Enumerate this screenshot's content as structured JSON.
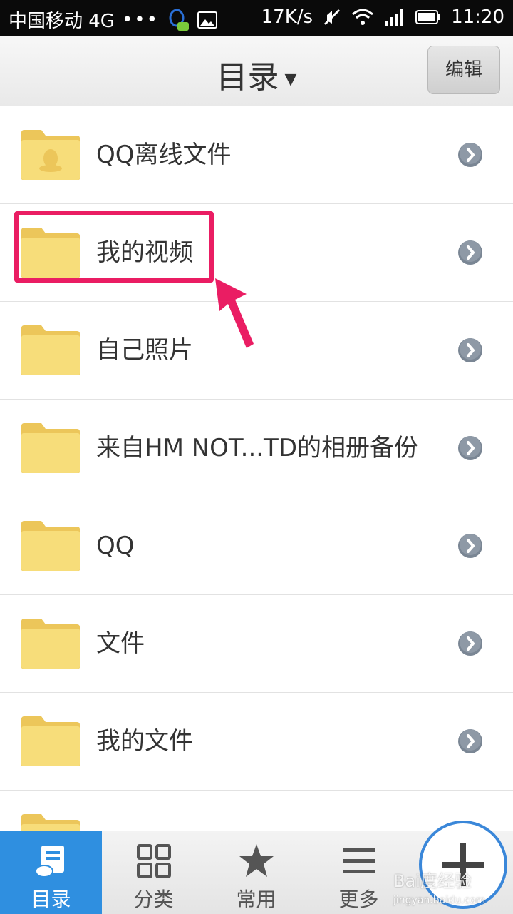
{
  "status_bar": {
    "carrier": "中国移动 4G",
    "dots": "•••",
    "speed": "17K/s",
    "time": "11:20"
  },
  "header": {
    "title": "目录",
    "edit_label": "编辑"
  },
  "folders": [
    {
      "label": "QQ离线文件",
      "icon": "qq-folder-icon"
    },
    {
      "label": "我的视频",
      "icon": "folder-icon"
    },
    {
      "label": "自己照片",
      "icon": "folder-icon"
    },
    {
      "label": "来自HM NOT...TD的相册备份",
      "icon": "folder-icon"
    },
    {
      "label": "QQ",
      "icon": "folder-icon"
    },
    {
      "label": "文件",
      "icon": "folder-icon"
    },
    {
      "label": "我的文件",
      "icon": "folder-icon"
    }
  ],
  "bottom_nav": {
    "items": [
      {
        "label": "目录",
        "icon": "directory-icon",
        "active": true
      },
      {
        "label": "分类",
        "icon": "grid-icon",
        "active": false
      },
      {
        "label": "常用",
        "icon": "star-icon",
        "active": false
      },
      {
        "label": "更多",
        "icon": "menu-icon",
        "active": false
      }
    ]
  },
  "watermark": {
    "brand": "Bai度经验",
    "url": "jingyan.baidu.com"
  },
  "colors": {
    "highlight": "#ea1d63",
    "accent": "#2f8fe0",
    "folder": "#f7dd7a"
  }
}
